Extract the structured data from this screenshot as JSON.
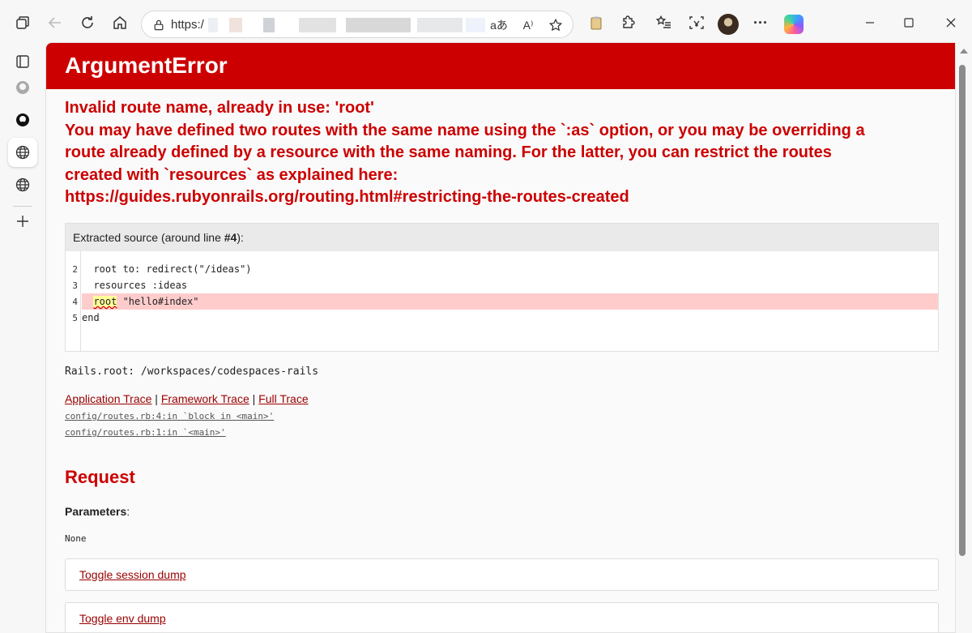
{
  "browser": {
    "url_prefix": "https:/"
  },
  "page": {
    "error_title": "ArgumentError",
    "message_lines": [
      "Invalid route name, already in use: 'root'",
      "You may have defined two routes with the same name using the `:as` option, or you may be overriding a",
      "route already defined by a resource with the same naming. For the latter, you can restrict the routes",
      "created with `resources` as explained here:",
      "https://guides.rubyonrails.org/routing.html#restricting-the-routes-created"
    ],
    "source": {
      "heading_prefix": "Extracted source (around line ",
      "heading_line": "#4",
      "heading_suffix": "):",
      "lines": [
        {
          "num": "2",
          "code": "  root to: redirect(\"/ideas\")"
        },
        {
          "num": "3",
          "code": "  resources :ideas"
        },
        {
          "num": "4",
          "code_before": "  ",
          "code_err": "root",
          "code_after": " \"hello#index\""
        },
        {
          "num": "5",
          "code": "end"
        }
      ]
    },
    "rails_root": "Rails.root: /workspaces/codespaces-rails",
    "traces": {
      "application": "Application Trace",
      "sep1": " | ",
      "framework": "Framework Trace",
      "sep2": " | ",
      "full": "Full Trace",
      "lines": [
        "config/routes.rb:4:in `block in <main>'",
        "config/routes.rb:1:in `<main>'"
      ]
    },
    "request_title": "Request",
    "parameters_label": "Parameters",
    "parameters_colon": ":",
    "parameters_value": "None",
    "toggles": [
      "Toggle session dump",
      "Toggle env dump"
    ]
  }
}
